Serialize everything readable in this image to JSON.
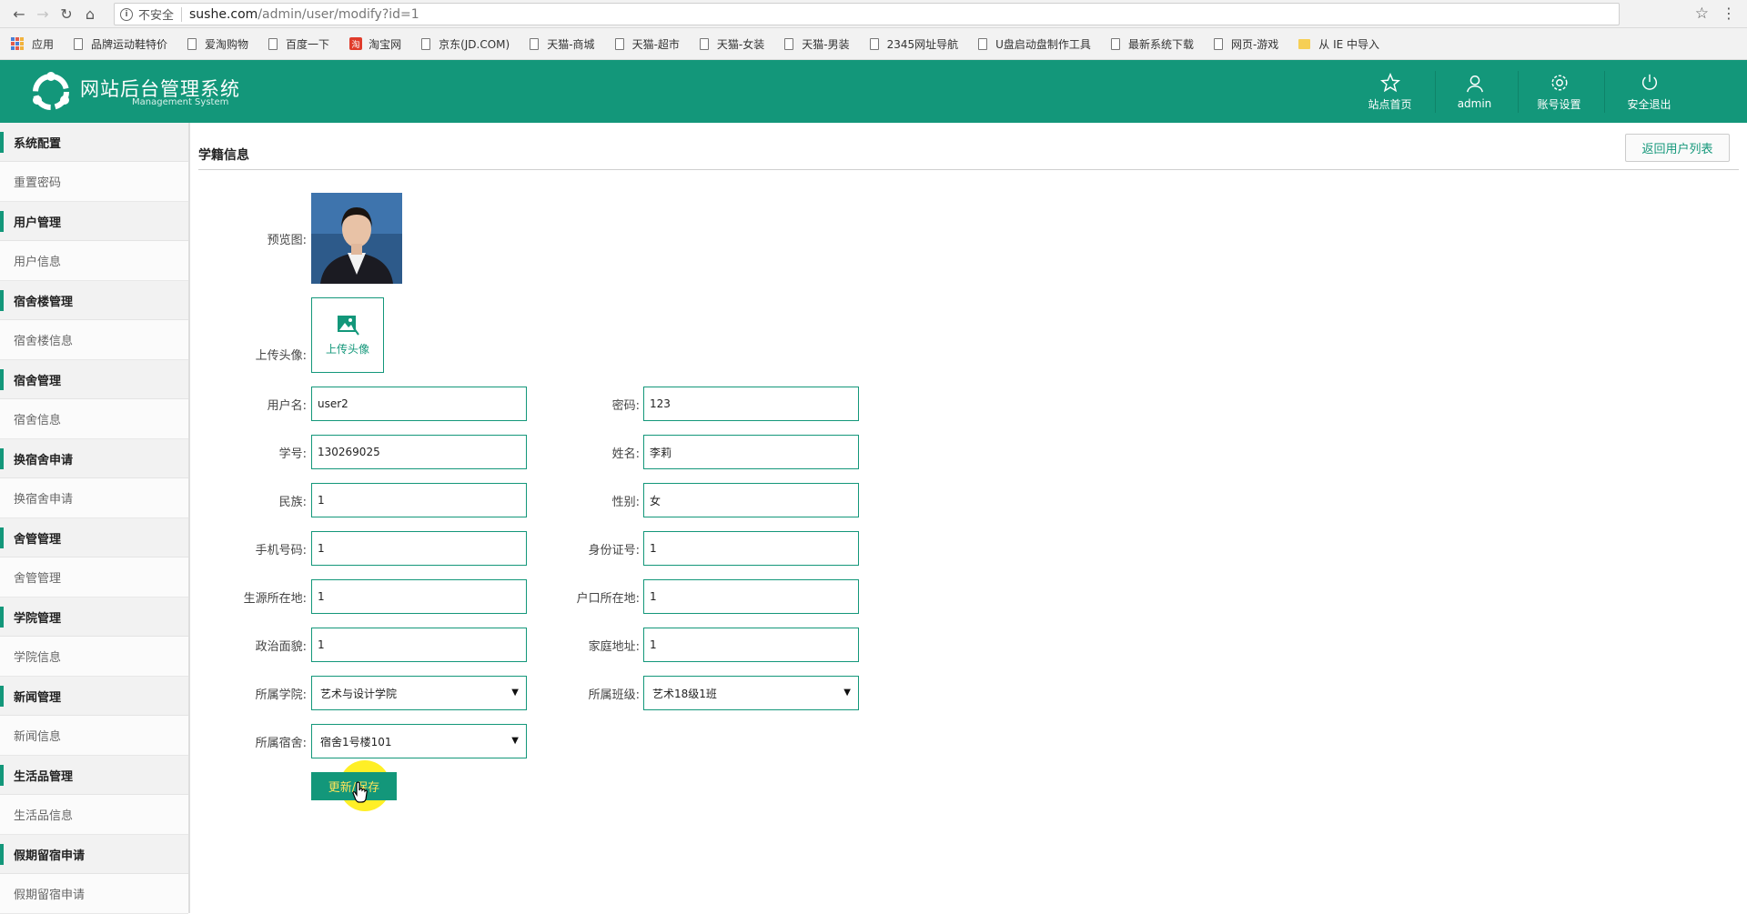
{
  "browser": {
    "insecure_label": "不安全",
    "url_host": "sushe.com",
    "url_path": "/admin/user/modify?id=1",
    "bookmarks": [
      "应用",
      "品牌运动鞋特价",
      "爱淘购物",
      "百度一下",
      "淘宝网",
      "京东(JD.COM)",
      "天猫-商城",
      "天猫-超市",
      "天猫-女装",
      "天猫-男装",
      "2345网址导航",
      "U盘启动盘制作工具",
      "最新系统下载",
      "网页-游戏",
      "从 IE 中导入"
    ]
  },
  "header": {
    "title": "网站后台管理系统",
    "subtitle": "Management System",
    "nav": [
      "站点首页",
      "admin",
      "账号设置",
      "安全退出"
    ],
    "brand_color": "#13977a"
  },
  "sidebar": {
    "groups": [
      {
        "title": "系统配置",
        "item": "重置密码"
      },
      {
        "title": "用户管理",
        "item": "用户信息"
      },
      {
        "title": "宿舍楼管理",
        "item": "宿舍楼信息"
      },
      {
        "title": "宿舍管理",
        "item": "宿舍信息"
      },
      {
        "title": "换宿舍申请",
        "item": "换宿舍申请"
      },
      {
        "title": "舍管管理",
        "item": "舍管管理"
      },
      {
        "title": "学院管理",
        "item": "学院信息"
      },
      {
        "title": "新闻管理",
        "item": "新闻信息"
      },
      {
        "title": "生活品管理",
        "item": "生活品信息"
      },
      {
        "title": "假期留宿申请",
        "item": "假期留宿申请"
      }
    ]
  },
  "main": {
    "title": "学籍信息",
    "back_button": "返回用户列表",
    "preview_label": "预览图:",
    "upload_label": "上传头像:",
    "upload_button": "上传头像",
    "save_button": "更新/保存",
    "fields": {
      "username": {
        "label": "用户名:",
        "value": "user2"
      },
      "password": {
        "label": "密码:",
        "value": "123"
      },
      "student_id": {
        "label": "学号:",
        "value": "130269025"
      },
      "name": {
        "label": "姓名:",
        "value": "李莉"
      },
      "ethnicity": {
        "label": "民族:",
        "value": "1"
      },
      "gender": {
        "label": "性别:",
        "value": "女"
      },
      "phone": {
        "label": "手机号码:",
        "value": "1"
      },
      "id_card": {
        "label": "身份证号:",
        "value": "1"
      },
      "origin": {
        "label": "生源所在地:",
        "value": "1"
      },
      "household": {
        "label": "户口所在地:",
        "value": "1"
      },
      "politics": {
        "label": "政治面貌:",
        "value": "1"
      },
      "address": {
        "label": "家庭地址:",
        "value": "1"
      },
      "college": {
        "label": "所属学院:",
        "value": "艺术与设计学院"
      },
      "class": {
        "label": "所属班级:",
        "value": "艺术18级1班"
      },
      "dorm": {
        "label": "所属宿舍:",
        "value": "宿舍1号楼101"
      }
    }
  }
}
